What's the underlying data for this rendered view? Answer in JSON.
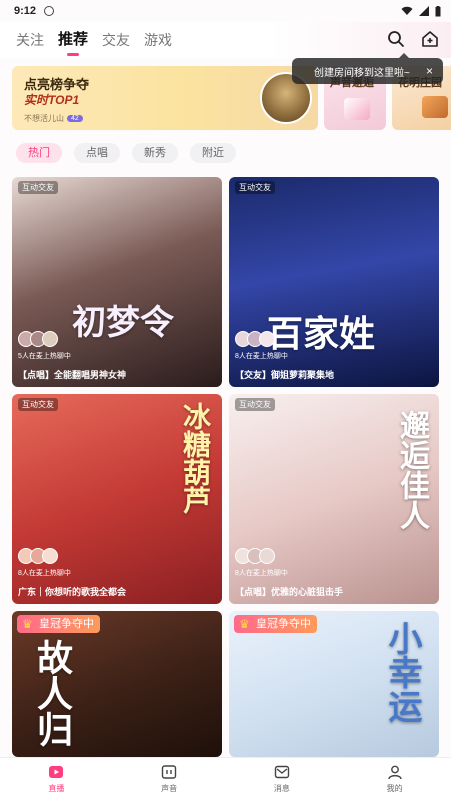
{
  "status_bar": {
    "time": "9:12"
  },
  "tabs": [
    {
      "label": "关注"
    },
    {
      "label": "推荐"
    },
    {
      "label": "交友"
    },
    {
      "label": "游戏"
    }
  ],
  "banner": {
    "title": "点亮榜争夺",
    "subtitle": "实时TOP1",
    "note": "不想活儿山",
    "note_count": "42",
    "card2_label": "声音邂逅",
    "card3_label": "花明庄园"
  },
  "tooltip": {
    "text": "创建房间移到这里啦~",
    "close": "×"
  },
  "filters": [
    {
      "label": "热门"
    },
    {
      "label": "点唱"
    },
    {
      "label": "新秀"
    },
    {
      "label": "附近"
    }
  ],
  "rooms": [
    {
      "badge": "互动交友",
      "art": "初梦令",
      "online": "5人在麦上热聊中",
      "title": "【点唱】全能翻唱男神女神"
    },
    {
      "badge": "互动交友",
      "art": "百家姓",
      "online": "8人在麦上热聊中",
      "title": "【交友】御姐萝莉聚集地"
    },
    {
      "badge": "互动交友",
      "art": "冰糖葫芦",
      "online": "8人在麦上热聊中",
      "title": "广东｜你想听的歌我全都会"
    },
    {
      "badge": "互动交友",
      "art": "邂逅佳人",
      "online": "8人在麦上热聊中",
      "title": "【点唱】优雅的心脏狙击手"
    },
    {
      "crown": "皇冠争夺中",
      "art": "故人归"
    },
    {
      "crown": "皇冠争夺中",
      "art": "小幸运"
    }
  ],
  "bottom_nav": [
    {
      "label": "直播",
      "icon": "live-icon"
    },
    {
      "label": "声音",
      "icon": "voice-icon"
    },
    {
      "label": "消息",
      "icon": "message-icon"
    },
    {
      "label": "我的",
      "icon": "profile-icon"
    }
  ],
  "colors": {
    "accent": "#ff3d7f",
    "banner_bg": "#fbe3a0"
  }
}
